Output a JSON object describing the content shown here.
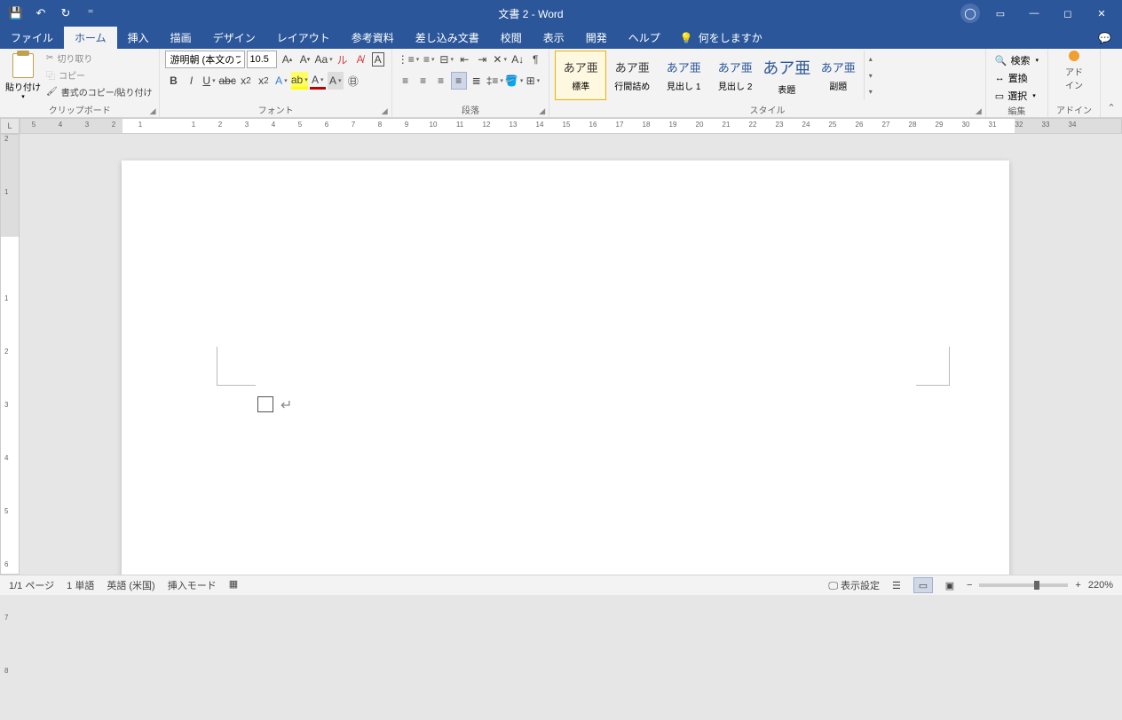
{
  "title": "文書 2  -  Word",
  "qat": {
    "save": "💾",
    "undo": "↶",
    "redo": "↻",
    "more": "⁼"
  },
  "tabs": {
    "file": "ファイル",
    "home": "ホーム",
    "insert": "挿入",
    "draw": "描画",
    "design": "デザイン",
    "layout": "レイアウト",
    "references": "参考資料",
    "mailings": "差し込み文書",
    "review": "校閲",
    "view": "表示",
    "developer": "開発",
    "help": "ヘルプ",
    "tellme": "何をしますか"
  },
  "ribbon": {
    "clipboard": {
      "label": "クリップボード",
      "paste": "貼り付け",
      "cut": "切り取り",
      "copy": "コピー",
      "format_painter": "書式のコピー/貼り付け"
    },
    "font": {
      "label": "フォント",
      "name": "游明朝 (本文のフォン",
      "size": "10.5"
    },
    "paragraph": {
      "label": "段落"
    },
    "styles": {
      "label": "スタイル",
      "items": [
        {
          "preview": "あア亜",
          "name": "標準",
          "cls": ""
        },
        {
          "preview": "あア亜",
          "name": "行間詰め",
          "cls": ""
        },
        {
          "preview": "あア亜",
          "name": "見出し 1",
          "cls": "heading"
        },
        {
          "preview": "あア亜",
          "name": "見出し 2",
          "cls": "heading"
        },
        {
          "preview": "あア亜",
          "name": "表題",
          "cls": "heading big"
        },
        {
          "preview": "あア亜",
          "name": "副題",
          "cls": "heading"
        }
      ]
    },
    "editing": {
      "label": "編集",
      "find": "検索",
      "replace": "置換",
      "select": "選択"
    },
    "addin": {
      "label": "アドイン",
      "text1": "アド",
      "text2": "イン"
    }
  },
  "status": {
    "page": "1/1 ページ",
    "words": "1 単語",
    "lang": "英語 (米国)",
    "mode": "挿入モード",
    "display": "表示設定",
    "zoom": "220%"
  }
}
